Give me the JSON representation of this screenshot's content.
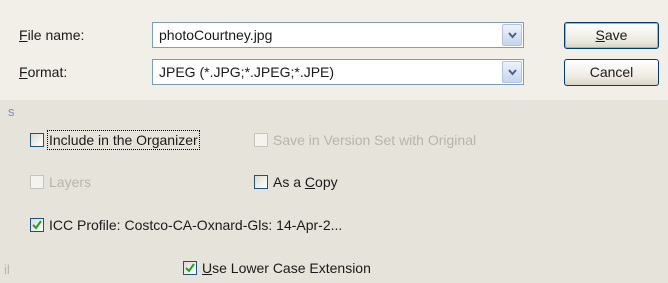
{
  "dialog": {
    "file_name_label": "File name:",
    "file_name_value": "photoCourtney.jpg",
    "format_label": "Format:",
    "format_value": "JPEG (*.JPG;*.JPEG;*.JPE)",
    "save_label": "Save",
    "cancel_label": "Cancel"
  },
  "options": {
    "include_organizer": {
      "label": "Include in the Organizer",
      "checked": false,
      "enabled": true
    },
    "version_set": {
      "label": "Save in Version Set with Original",
      "checked": false,
      "enabled": false
    },
    "layers": {
      "label": "Layers",
      "checked": false,
      "enabled": false
    },
    "as_copy": {
      "label": "As a Copy",
      "checked": false,
      "enabled": true
    },
    "icc_profile": {
      "label": "ICC Profile:  Costco-CA-Oxnard-Gls: 14-Apr-2...",
      "checked": true,
      "enabled": true
    },
    "lower_case_ext": {
      "label": "Use Lower Case Extension",
      "checked": true,
      "enabled": true
    }
  },
  "edge_text": {
    "left_s": "s",
    "left_il": "il"
  },
  "colors": {
    "accent": "#1c5180",
    "check": "#21a121",
    "disabled_text": "#b6b4ac"
  }
}
